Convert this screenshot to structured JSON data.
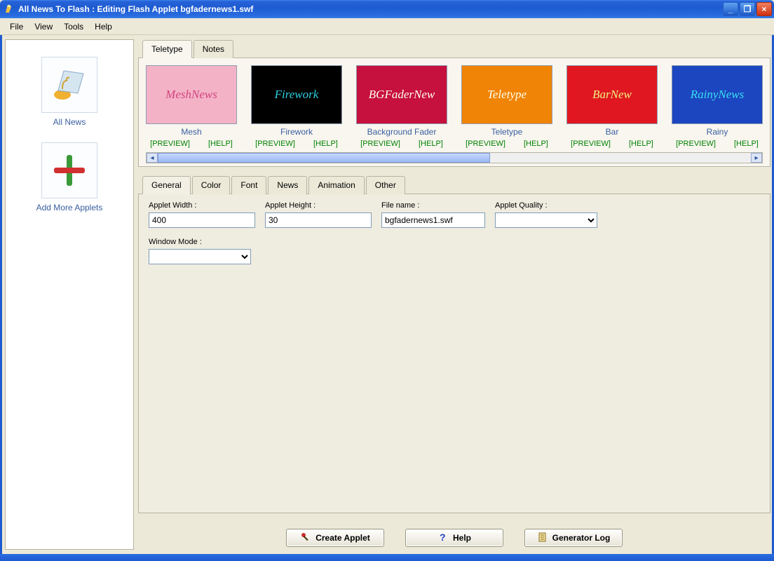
{
  "window": {
    "title": "All News To Flash : Editing Flash Applet bgfadernews1.swf"
  },
  "menu": {
    "file": "File",
    "view": "View",
    "tools": "Tools",
    "help": "Help"
  },
  "sidebar": {
    "allnews_label": "All News",
    "addmore_label": "Add More Applets"
  },
  "topTabs": {
    "teletype": "Teletype",
    "notes": "Notes"
  },
  "gallery": {
    "preview": "[PREVIEW]",
    "help": "[HELP]",
    "items": [
      {
        "label": "Mesh",
        "thumbtext": "MeshNews",
        "cls": "mesh"
      },
      {
        "label": "Firework",
        "thumbtext": "Firework",
        "cls": "firework"
      },
      {
        "label": "Background Fader",
        "thumbtext": "BGFaderNew",
        "cls": "bgfader"
      },
      {
        "label": "Teletype",
        "thumbtext": "Teletype",
        "cls": "teletype"
      },
      {
        "label": "Bar",
        "thumbtext": "BarNew",
        "cls": "bar"
      },
      {
        "label": "Rainy",
        "thumbtext": "RainyNews",
        "cls": "rainy"
      }
    ]
  },
  "lowerTabs": {
    "general": "General",
    "color": "Color",
    "font": "Font",
    "news": "News",
    "animation": "Animation",
    "other": "Other"
  },
  "form": {
    "appletWidth": {
      "label": "Applet Width :",
      "value": "400"
    },
    "appletHeight": {
      "label": "Applet Height :",
      "value": "30"
    },
    "fileName": {
      "label": "File name :",
      "value": "bgfadernews1.swf"
    },
    "appletQuality": {
      "label": "Applet Quality :",
      "value": ""
    },
    "windowMode": {
      "label": "Window Mode :",
      "value": ""
    }
  },
  "buttons": {
    "create": "Create Applet",
    "help": "Help",
    "log": "Generator Log"
  }
}
